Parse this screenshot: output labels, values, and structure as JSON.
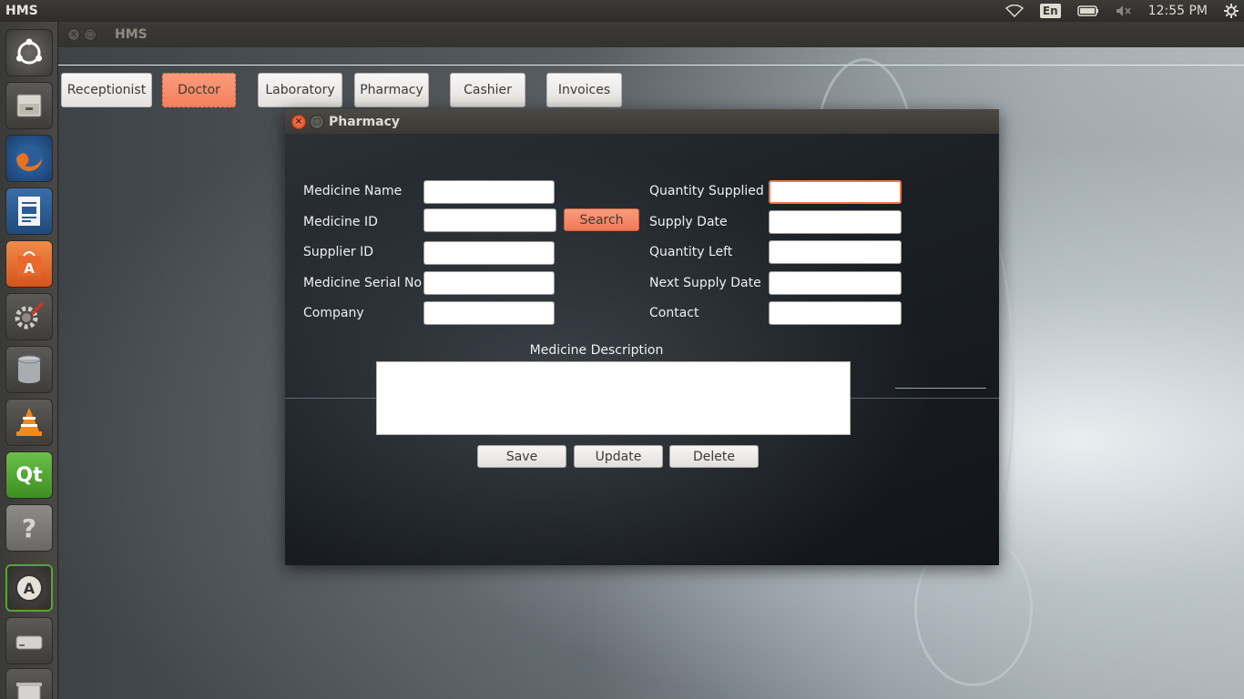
{
  "top_panel": {
    "app_name": "HMS",
    "language": "En",
    "clock": "12:55 PM"
  },
  "main_window": {
    "title": "HMS",
    "modules": [
      {
        "label": "Receptionist"
      },
      {
        "label": "Doctor"
      },
      {
        "label": "Laboratory"
      },
      {
        "label": "Pharmacy"
      },
      {
        "label": "Cashier"
      },
      {
        "label": "Invoices"
      }
    ]
  },
  "dialog": {
    "title": "Pharmacy",
    "fields_left": [
      {
        "label": "Medicine Name",
        "value": ""
      },
      {
        "label": "Medicine ID",
        "value": ""
      },
      {
        "label": "Supplier ID",
        "value": ""
      },
      {
        "label": "Medicine Serial No",
        "value": ""
      },
      {
        "label": "Company",
        "value": ""
      }
    ],
    "fields_right": [
      {
        "label": "Quantity Supplied",
        "value": ""
      },
      {
        "label": "Supply Date",
        "value": ""
      },
      {
        "label": "Quantity Left",
        "value": ""
      },
      {
        "label": "Next Supply Date",
        "value": ""
      },
      {
        "label": "Contact",
        "value": ""
      }
    ],
    "search_label": "Search",
    "description_label": "Medicine Description",
    "description_value": "",
    "save_label": "Save",
    "update_label": "Update",
    "delete_label": "Delete"
  },
  "colors": {
    "accent": "#f3805d",
    "panel": "#3c3b37"
  }
}
